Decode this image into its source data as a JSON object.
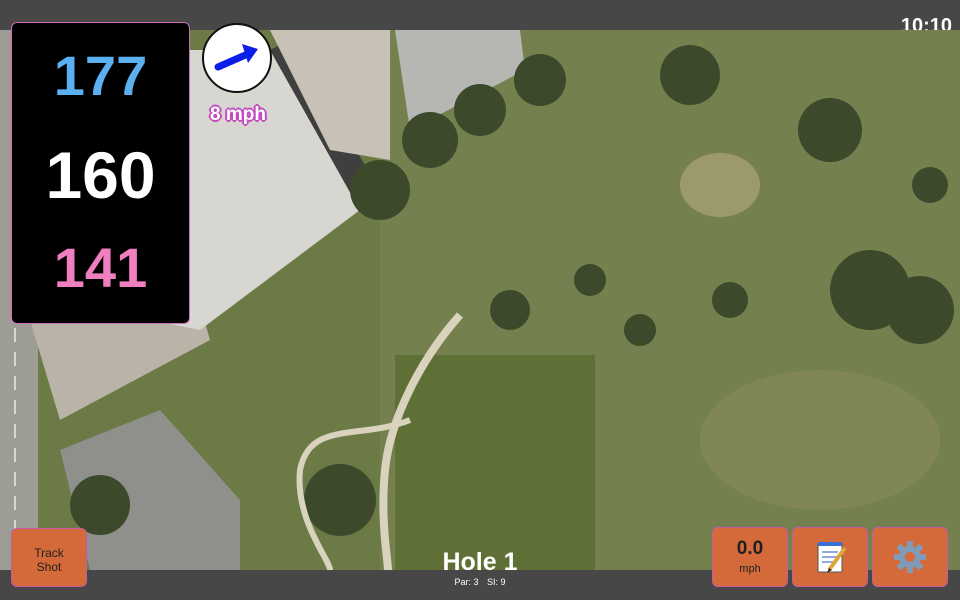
{
  "status": {
    "time": "10:10"
  },
  "distances": {
    "back": "177",
    "middle": "160",
    "front": "141"
  },
  "wind": {
    "speed": "8 mph",
    "arrow_icon": "arrow-right-icon"
  },
  "hole": {
    "title": "Hole 1",
    "par": "Par: 3",
    "si": "SI: 9"
  },
  "buttons": {
    "track_shot": [
      "Track",
      "Shot"
    ],
    "wind_value": "0.0",
    "wind_unit": "mph",
    "notes_icon": "notepad-icon",
    "settings_icon": "gear-icon"
  },
  "colors": {
    "back": "#5ab0f0",
    "middle": "#ffffff",
    "front": "#f07fc0",
    "button": "#d46a3a",
    "bar": "#474747"
  }
}
